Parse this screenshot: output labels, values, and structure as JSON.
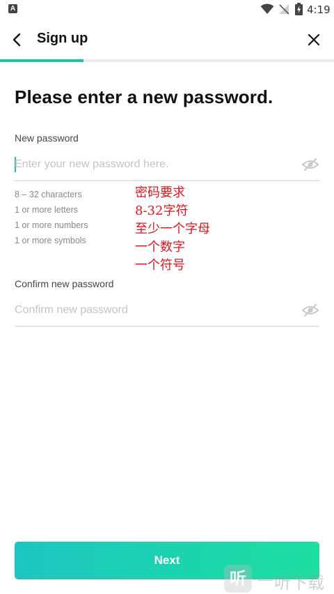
{
  "status_bar": {
    "time": "4:19",
    "app_badge": "A"
  },
  "header": {
    "title": "Sign up",
    "progress": 0.25
  },
  "page": {
    "title": "Please enter a new password."
  },
  "new_password": {
    "label": "New password",
    "placeholder": "Enter your new password here.",
    "value": ""
  },
  "requirements": [
    "8 – 32 characters",
    "1 or more letters",
    "1 or more numbers",
    "1 or more symbols"
  ],
  "annotation": [
    "密码要求",
    "8-32字符",
    "至少一个字母",
    "一个数字",
    "一个符号"
  ],
  "confirm_password": {
    "label": "Confirm new password",
    "placeholder": "Confirm new password",
    "value": ""
  },
  "footer": {
    "next_label": "Next"
  },
  "watermark": {
    "logo": "听",
    "text": "听下载"
  },
  "colors": {
    "accent": "#1fc3a8",
    "button_start": "#1cc6c1",
    "button_end": "#1ddfa0",
    "annotation": "#e0141c"
  }
}
